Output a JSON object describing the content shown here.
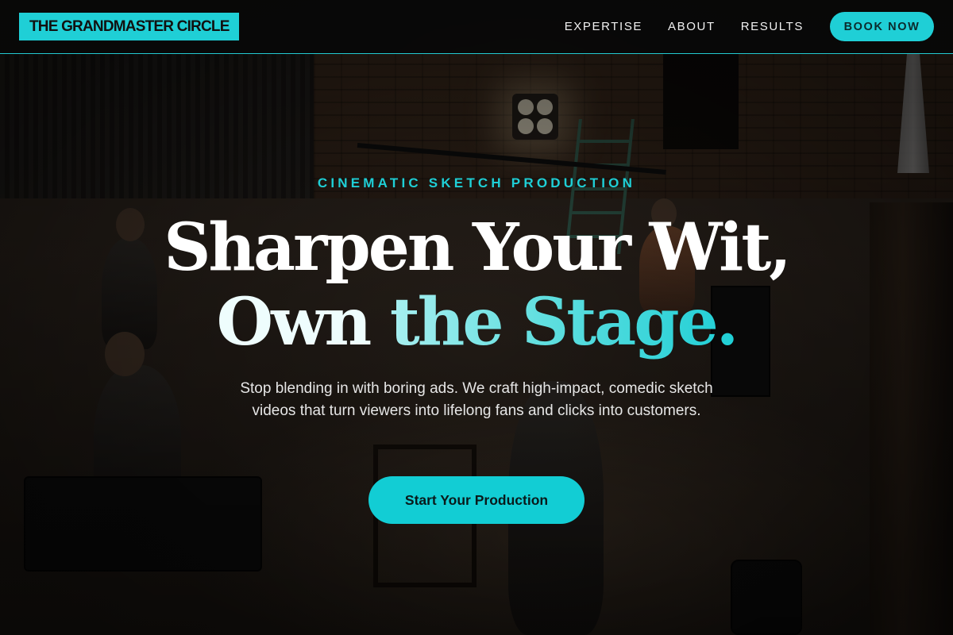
{
  "header": {
    "logo_text": "THE GRANDMASTER CIRCLE",
    "nav": [
      {
        "label": "EXPERTISE"
      },
      {
        "label": "ABOUT"
      },
      {
        "label": "RESULTS"
      }
    ],
    "book_label": "BOOK NOW"
  },
  "hero": {
    "eyebrow": "CINEMATIC SKETCH PRODUCTION",
    "headline_line1": "Sharpen Your Wit,",
    "headline_line2_part1": "Own ",
    "headline_line2_part2": "the Stage.",
    "subtitle": "Stop blending in with boring ads. We craft high-impact, comedic sketch videos that turn viewers into lifelong fans and clicks into customers.",
    "cta_label": "Start Your Production"
  },
  "colors": {
    "accent": "#1fcfd6",
    "header_bg": "#080808",
    "text": "#ffffff"
  }
}
